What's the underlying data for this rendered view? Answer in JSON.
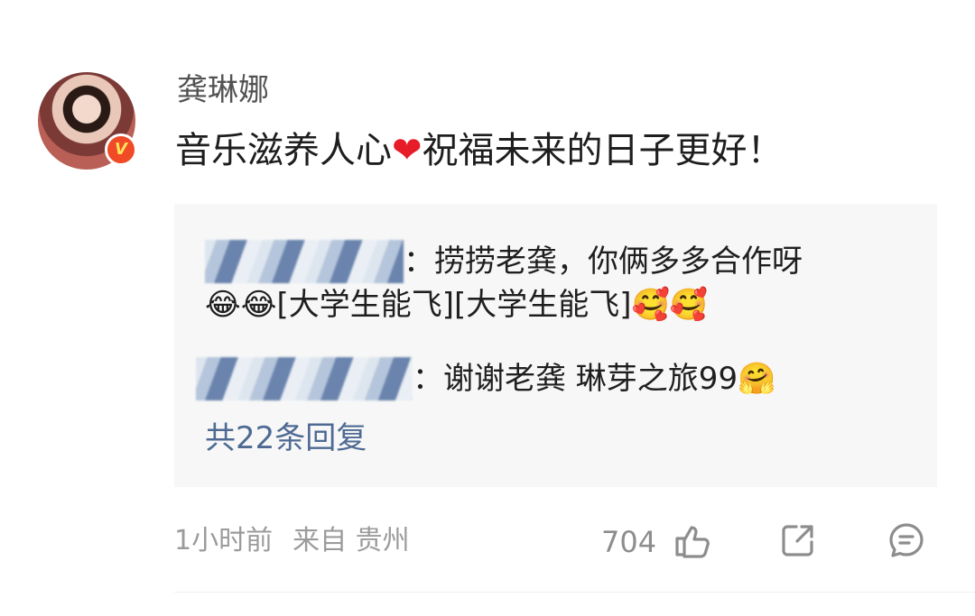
{
  "comment": {
    "username": "龚琳娜",
    "text_before": "音乐滋养人心",
    "heart": "❤",
    "text_after": "祝福未来的日子更好！",
    "verified_badge": "V"
  },
  "replies": [
    {
      "user": "",
      "text": "：捞捞老龚，你俩多多合作呀",
      "emoji_a": "😂😂",
      "tags": "[大学生能飞][大学生能飞]",
      "emoji_b": "🥰🥰"
    },
    {
      "user": "",
      "text": "：谢谢老龚 琳芽之旅99",
      "emoji": "🤗"
    }
  ],
  "replies_more": "共22条回复",
  "footer": {
    "time": "1小时前",
    "source": "来自 贵州",
    "likes": "704"
  },
  "icons": {
    "like": "thumbs-up-icon",
    "share": "share-icon",
    "comment": "comment-icon"
  },
  "colors": {
    "link": "#4e6a93",
    "heart": "#e61c28",
    "badge": "#f04a26",
    "muted": "#9b9b9b"
  }
}
